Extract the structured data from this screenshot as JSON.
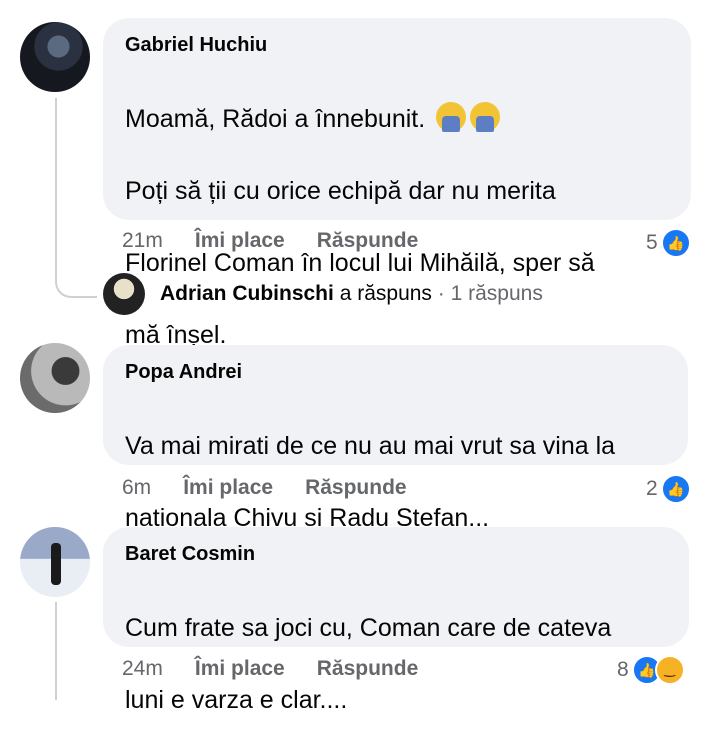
{
  "comments": [
    {
      "author": "Gabriel Huchiu",
      "lines": [
        "Moamă, Rădoi a înnebunit.",
        "Poți să ții cu orice echipă dar nu merita",
        "Florinel Coman în locul lui Mihăilă, sper să",
        "mă înșel."
      ],
      "emojis": [
        "face-palm-emoji",
        "face-palm-emoji"
      ],
      "time": "21m",
      "like_label": "Îmi place",
      "reply_label": "Răspunde",
      "reaction_count": "5",
      "reactions": [
        "like-icon"
      ]
    },
    {
      "author": "Popa Andrei",
      "lines": [
        "Va mai mirati de ce nu au mai vrut sa vina la",
        "nationala Chivu si Radu Stefan..."
      ],
      "time": "6m",
      "like_label": "Îmi place",
      "reply_label": "Răspunde",
      "reaction_count": "2",
      "reactions": [
        "like-icon"
      ]
    },
    {
      "author": "Baret Cosmin",
      "lines": [
        "Cum frate sa joci cu, Coman care de cateva",
        "luni e varza e clar...."
      ],
      "time": "24m",
      "like_label": "Îmi place",
      "reply_label": "Răspunde",
      "reaction_count": "8",
      "reactions": [
        "like-icon",
        "haha-icon"
      ]
    }
  ],
  "reply_summary": {
    "author": "Adrian Cubinschi",
    "action": "a răspuns",
    "separator": "·",
    "count": "1 răspuns"
  },
  "colors": {
    "bubble": "#f0f2f5",
    "meta_text": "#65676b",
    "like_blue": "#1877f2",
    "thread_line": "#ced0d4"
  }
}
